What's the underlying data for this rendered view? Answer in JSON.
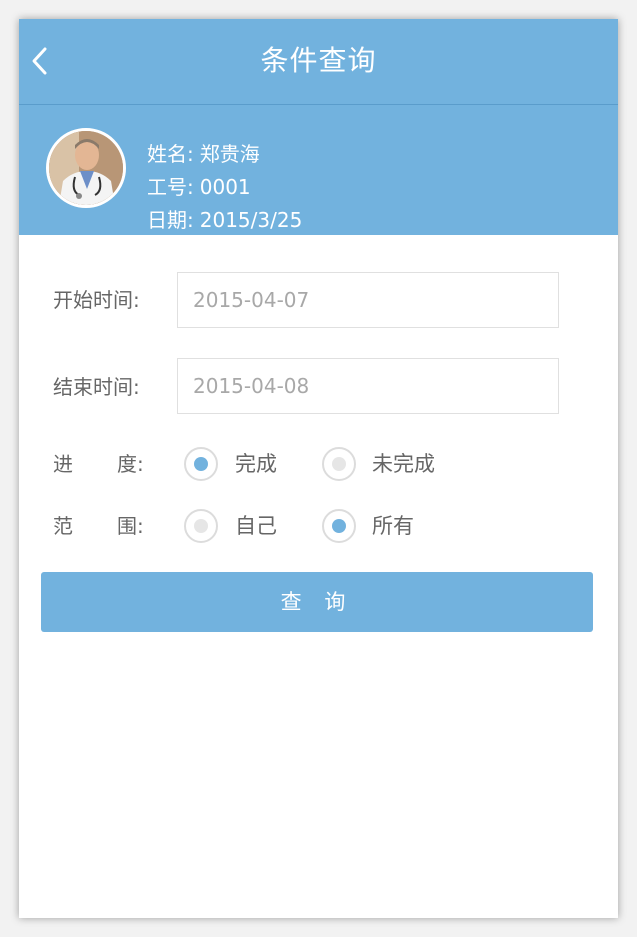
{
  "header": {
    "title": "条件查询",
    "back_icon": "chevron-left-icon"
  },
  "colors": {
    "primary": "#72b2de",
    "text": "#666666",
    "placeholder": "#a8a8a8"
  },
  "profile": {
    "name_label": "姓名:",
    "name_value": "郑贵海",
    "id_label": "工号:",
    "id_value": "0001",
    "date_label": "日期:",
    "date_value": "2015/3/25"
  },
  "form": {
    "start_label": "开始时间:",
    "start_value": "2015-04-07",
    "end_label": "结束时间:",
    "end_value": "2015-04-08",
    "progress_label_a": "进",
    "progress_label_b": "度:",
    "progress_options": [
      {
        "label": "完成",
        "checked": true
      },
      {
        "label": "未完成",
        "checked": false
      }
    ],
    "scope_label_a": "范",
    "scope_label_b": "围:",
    "scope_options": [
      {
        "label": "自己",
        "checked": false
      },
      {
        "label": "所有",
        "checked": true
      }
    ]
  },
  "query_button": "查 询"
}
